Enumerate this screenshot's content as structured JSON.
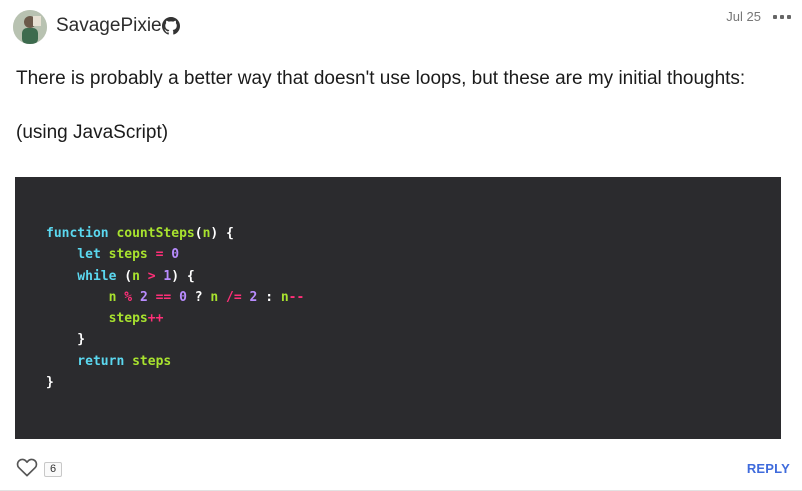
{
  "post": {
    "author": "SavagePixie",
    "author_badge_icon": "github-icon",
    "date": "Jul 25",
    "paragraphs": [
      "There is probably a better way that doesn't use loops, but these are my initial thoughts:",
      "(using JavaScript)"
    ],
    "code_lines": [
      [
        {
          "t": "function ",
          "c": "kw"
        },
        {
          "t": "countSteps",
          "c": "fn"
        },
        {
          "t": "(",
          "c": "plain"
        },
        {
          "t": "n",
          "c": "var"
        },
        {
          "t": ") {",
          "c": "plain"
        }
      ],
      [
        {
          "t": "    let ",
          "c": "kw"
        },
        {
          "t": "steps ",
          "c": "var"
        },
        {
          "t": "= ",
          "c": "op"
        },
        {
          "t": "0",
          "c": "num"
        }
      ],
      [
        {
          "t": "    while ",
          "c": "kw"
        },
        {
          "t": "(",
          "c": "plain"
        },
        {
          "t": "n ",
          "c": "var"
        },
        {
          "t": "> ",
          "c": "op"
        },
        {
          "t": "1",
          "c": "num"
        },
        {
          "t": ") {",
          "c": "plain"
        }
      ],
      [
        {
          "t": "        n ",
          "c": "var"
        },
        {
          "t": "% ",
          "c": "op"
        },
        {
          "t": "2 ",
          "c": "num"
        },
        {
          "t": "== ",
          "c": "op"
        },
        {
          "t": "0 ",
          "c": "num"
        },
        {
          "t": "? ",
          "c": "plain"
        },
        {
          "t": "n ",
          "c": "var"
        },
        {
          "t": "/= ",
          "c": "op"
        },
        {
          "t": "2 ",
          "c": "num"
        },
        {
          "t": ": ",
          "c": "plain"
        },
        {
          "t": "n",
          "c": "var"
        },
        {
          "t": "--",
          "c": "op"
        }
      ],
      [
        {
          "t": "        steps",
          "c": "var"
        },
        {
          "t": "++",
          "c": "op"
        }
      ],
      [
        {
          "t": "    }",
          "c": "plain"
        }
      ],
      [
        {
          "t": "    return ",
          "c": "kw"
        },
        {
          "t": "steps",
          "c": "var"
        }
      ],
      [
        {
          "t": "}",
          "c": "plain"
        }
      ]
    ],
    "like_count": "6",
    "reply_label": "REPLY"
  },
  "colors": {
    "code_background": "#2b2b2e",
    "keyword": "#5bd8f0",
    "identifier": "#a8e22e",
    "number": "#b98cff",
    "operator": "#ff2f78",
    "reply_link": "#3f6bdc"
  },
  "icons": {
    "avatar": "avatar-image",
    "more": "more-horizontal-icon",
    "like": "heart-icon"
  }
}
